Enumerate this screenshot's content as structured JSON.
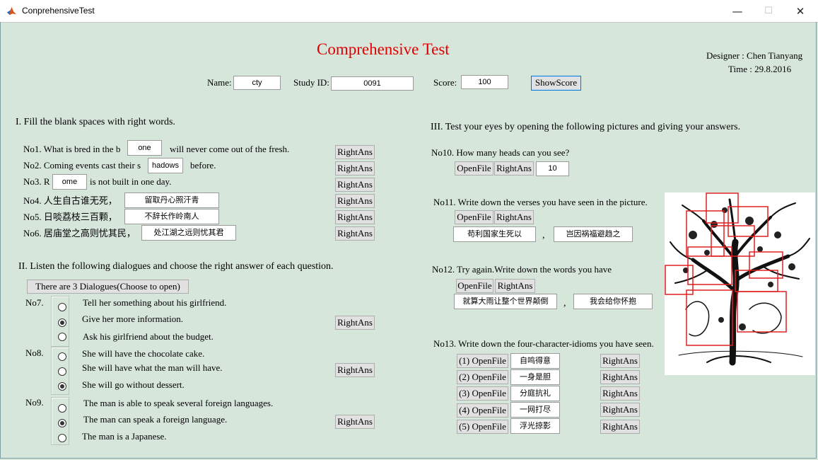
{
  "window": {
    "title": "ConprehensiveTest"
  },
  "header": {
    "title": "Comprehensive Test",
    "designer": "Designer : Chen Tianyang",
    "time": "Time : 29.8.2016",
    "name_label": "Name:",
    "name_value": "cty",
    "id_label": "Study ID:",
    "id_value": "0091",
    "score_label": "Score:",
    "score_value": "100",
    "show_score": "ShowScore"
  },
  "section1": {
    "heading": "I.  Fill the blank spaces with right words.",
    "q1": {
      "pre": "No1.  What is bred in the b",
      "answer": "one",
      "post": "will never come out of the fresh."
    },
    "q2": {
      "pre": "No2.  Coming events cast their s",
      "answer": "hadows",
      "post": "before."
    },
    "q3": {
      "pre": "No3.  R",
      "answer": "ome",
      "post": "is not built in one day."
    },
    "q4": {
      "pre": "No4.   人生自古谁无死，",
      "answer": "留取丹心照汗青"
    },
    "q5": {
      "pre": "No5.   日啖荔枝三百颗，",
      "answer": "不辞长作岭南人"
    },
    "q6": {
      "pre": "No6.   居庙堂之高则忧其民，",
      "answer": "处江湖之远则忧其君"
    },
    "right_ans": "RightAns"
  },
  "section2": {
    "heading": "II.  Listen the following dialogues and choose the right answer of each question.",
    "open_button": "There are 3 Dialogues(Choose to open)",
    "q7": {
      "label": "No7.",
      "options": [
        "Tell her something about his girlfriend.",
        "Give her more information.",
        "Ask his girlfriend about the budget."
      ],
      "selected": 1
    },
    "q8": {
      "label": "No8.",
      "options": [
        "She will have the chocolate cake.",
        "She will have what the man will have.",
        "She will go without dessert."
      ],
      "selected": 2
    },
    "q9": {
      "label": "No9.",
      "options": [
        "The man is able to speak several foreign languages.",
        "The man can speak a foreign language.",
        "The man is a Japanese."
      ],
      "selected": 1
    }
  },
  "section3": {
    "heading": "III.  Test your eyes by opening the following pictures and giving your answers.",
    "open_file": "OpenFile",
    "right_ans": "RightAns",
    "q10": {
      "text": "No10. How many heads can you see?",
      "answer": "10"
    },
    "q11": {
      "text": "No11. Write down the verses you have seen in the picture.",
      "answer1": "苟利国家生死以",
      "sep": ",",
      "answer2": "岂因祸福避趋之"
    },
    "q12": {
      "text": "No12. Try again.Write down the words you have",
      "answer1": "就算大雨让整个世界颠倒",
      "sep": ",",
      "answer2": "我会给你怀抱"
    },
    "q13": {
      "text": "No13. Write down the four-character-idioms you have seen.",
      "items": [
        {
          "label": "(1) OpenFile",
          "answer": "自鸣得意"
        },
        {
          "label": "(2) OpenFile",
          "answer": "一身是胆"
        },
        {
          "label": "(3) OpenFile",
          "answer": "分庭抗礼"
        },
        {
          "label": "(4) OpenFile",
          "answer": "一网打尽"
        },
        {
          "label": "(5) OpenFile",
          "answer": "浮光掠影"
        }
      ]
    }
  },
  "colors": {
    "background": "#d7e6db",
    "title_red": "#e00000",
    "highlight_red": "#e02020"
  }
}
